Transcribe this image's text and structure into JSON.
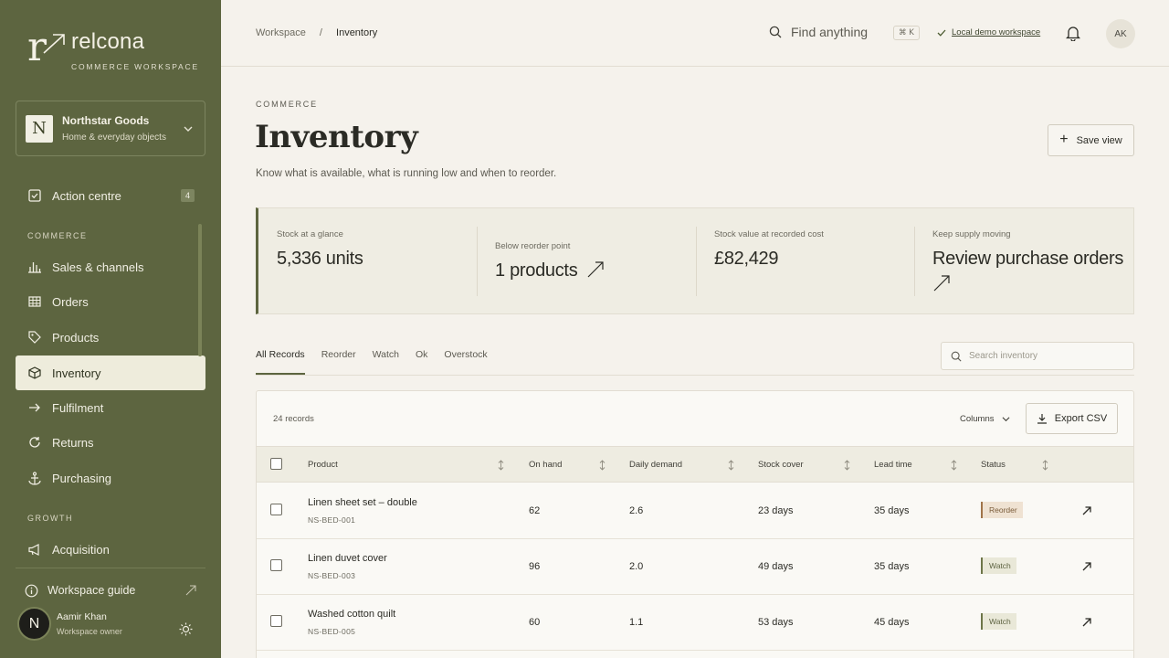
{
  "brand": {
    "name": "relcona",
    "tagline": "COMMERCE WORKSPACE",
    "mark": "r"
  },
  "org": {
    "initial": "N",
    "name": "Northstar Goods",
    "sub": "Home & everyday objects"
  },
  "nav": {
    "action_centre": {
      "label": "Action centre",
      "badge": "4"
    },
    "commerce_label": "COMMERCE",
    "commerce_items": [
      "Sales & channels",
      "Orders",
      "Products",
      "Inventory",
      "Fulfilment",
      "Returns",
      "Purchasing"
    ],
    "growth_label": "GROWTH",
    "growth_items": [
      "Acquisition"
    ],
    "active": "Inventory"
  },
  "guide": {
    "label": "Workspace guide"
  },
  "user": {
    "initial": "N",
    "name": "Aamir Khan",
    "role": "Workspace owner"
  },
  "topbar": {
    "breadcrumb": [
      "Workspace",
      "Inventory"
    ],
    "breadcrumb_sep": "/",
    "find": "Find anything",
    "shortcut": "⌘ K",
    "workspace": "Local demo workspace",
    "avatar": "AK"
  },
  "page": {
    "eyebrow": "COMMERCE",
    "title": "Inventory",
    "subtitle": "Know what is available, what is running low and when to reorder.",
    "save_view": "Save view"
  },
  "stats": [
    {
      "label": "Stock at a glance",
      "value": "5,336 units"
    },
    {
      "label": "Below reorder point",
      "value": "1 products"
    },
    {
      "label": "Stock value at recorded cost",
      "value": "£82,429"
    },
    {
      "label": "Keep supply moving",
      "value": "Review purchase orders"
    }
  ],
  "tabs": [
    "All Records",
    "Reorder",
    "Watch",
    "Ok",
    "Overstock"
  ],
  "search": {
    "placeholder": "Search inventory"
  },
  "table": {
    "records": "24 records",
    "columns_label": "Columns",
    "export_label": "Export CSV",
    "headers": [
      "Product",
      "On hand",
      "Daily demand",
      "Stock cover",
      "Lead time",
      "Status"
    ],
    "rows": [
      {
        "product": "Linen sheet set – double",
        "sku": "NS-BED-001",
        "on_hand": "62",
        "demand": "2.6",
        "cover": "23 days",
        "lead": "35 days",
        "status": "Reorder"
      },
      {
        "product": "Linen duvet cover",
        "sku": "NS-BED-003",
        "on_hand": "96",
        "demand": "2.0",
        "cover": "49 days",
        "lead": "35 days",
        "status": "Watch"
      },
      {
        "product": "Washed cotton quilt",
        "sku": "NS-BED-005",
        "on_hand": "60",
        "demand": "1.1",
        "cover": "53 days",
        "lead": "45 days",
        "status": "Watch"
      }
    ]
  },
  "colors": {
    "sidebar": "#5d6540",
    "accent": "#5d6540",
    "background": "#f5f2ec"
  }
}
